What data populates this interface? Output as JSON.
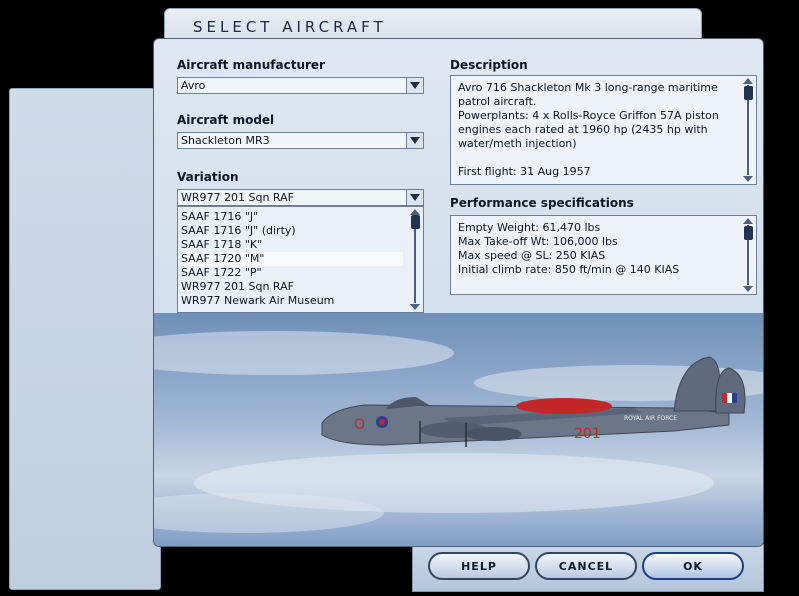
{
  "window": {
    "title": "SELECT AIRCRAFT"
  },
  "manufacturer": {
    "label": "Aircraft manufacturer",
    "value": "Avro"
  },
  "model": {
    "label": "Aircraft model",
    "value": "Shackleton MR3"
  },
  "variation": {
    "label": "Variation",
    "value": "WR977 201 Sqn RAF",
    "items": [
      "SAAF 1716 \"J\"",
      "SAAF 1716 \"J\" (dirty)",
      "SAAF 1718 \"K\"",
      "SAAF 1720 \"M\"",
      "SAAF 1722 \"P\"",
      "WR977 201 Sqn RAF",
      "WR977 Newark Air Museum"
    ],
    "highlighted_item": "SAAF 1720 \"M\""
  },
  "description": {
    "label": "Description",
    "paragraphs": [
      "Avro 716 Shackleton Mk 3 long-range maritime patrol aircraft.",
      "Powerplants: 4 x Rolls-Royce Griffon 57A piston engines each rated at 1960 hp (2435 hp with water/meth injection)",
      "",
      "First flight: 31 Aug 1957"
    ]
  },
  "performance": {
    "label": "Performance specifications",
    "lines": [
      "Empty Weight: 61,470 lbs",
      "Max Take-off Wt: 106,000 lbs",
      "Max speed @ SL: 250 KIAS",
      "Initial climb rate: 850 ft/min @ 140 KIAS"
    ]
  },
  "aircraft_markings": {
    "roundel_letter": "O",
    "number": "201",
    "fuselage_text": "ROYAL AIR FORCE"
  },
  "buttons": {
    "help": "HELP",
    "cancel": "CANCEL",
    "ok": "OK"
  },
  "colors": {
    "panel": "#d4e0ec",
    "sky": "#9fb7d3",
    "aircraft": "#6b7688",
    "accent_red": "#c0282a"
  }
}
